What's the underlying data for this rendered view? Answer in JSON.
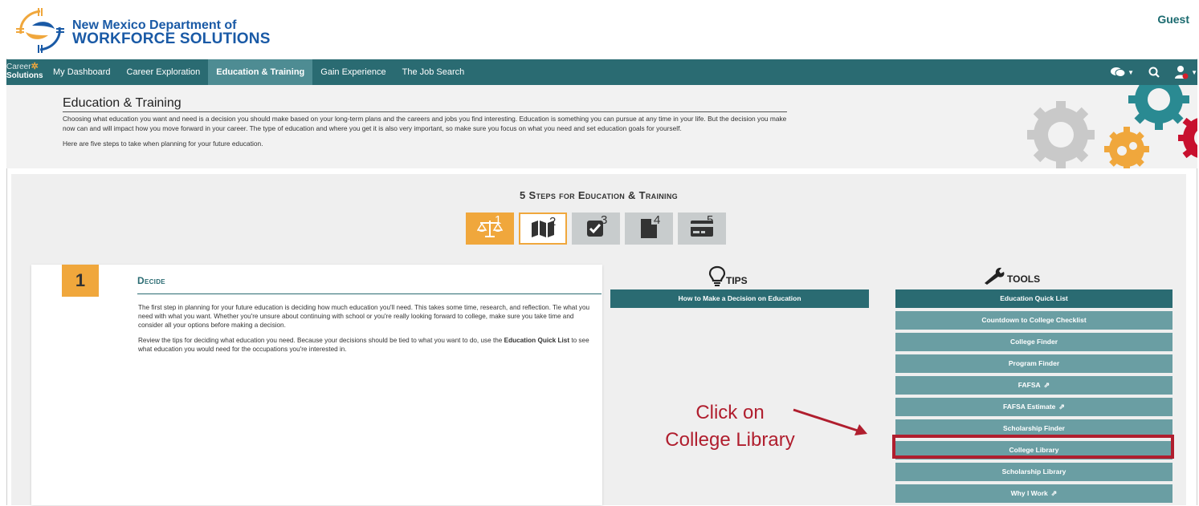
{
  "header": {
    "org_line1": "New Mexico Department of",
    "org_line2": "WORKFORCE SOLUTIONS",
    "user": "Guest"
  },
  "brand": {
    "line1": "Career",
    "line2": "Solutions"
  },
  "nav": {
    "items": [
      {
        "label": "My Dashboard"
      },
      {
        "label": "Career Exploration"
      },
      {
        "label": "Education & Training"
      },
      {
        "label": "Gain Experience"
      },
      {
        "label": "The Job Search"
      }
    ],
    "active_index": 2,
    "right_icons": [
      "chat-icon",
      "search-icon",
      "user-icon"
    ]
  },
  "intro": {
    "title": "Education & Training",
    "paragraph1": "Choosing what education you want and need is a decision you should make based on your long-term plans and the careers and jobs you find interesting. Education is something you can pursue at any time in your life. But the decision you make now can and will impact how you move forward in your career. The type of education and where you get it is also very important, so make sure you focus on what you need and set education goals for yourself.",
    "paragraph2": "Here are five steps to take when planning for your future education."
  },
  "steps": {
    "title": "5 Steps for Education & Training",
    "items": [
      {
        "num": "1",
        "icon": "scales-icon"
      },
      {
        "num": "2",
        "icon": "map-icon"
      },
      {
        "num": "3",
        "icon": "checkbox-icon"
      },
      {
        "num": "4",
        "icon": "document-icon"
      },
      {
        "num": "5",
        "icon": "credit-card-icon"
      }
    ]
  },
  "card": {
    "number": "1",
    "title": "Decide",
    "paragraph1": "The first step in planning for your future education is deciding how much education you'll need. This takes some time, research, and reflection. Tie what you need with what you want. Whether you're unsure about continuing with school or you're really looking forward to college, make sure you take time and consider all your options before making a decision.",
    "paragraph2_pre": "Review the tips for deciding what education you need. Because your decisions should be tied to what you want to do, use the ",
    "paragraph2_bold": "Education Quick List",
    "paragraph2_post": " to see what education you would need for the occupations you're interested in."
  },
  "tips": {
    "heading": "TIPS",
    "items": [
      {
        "label": "How to Make a Decision on Education"
      }
    ]
  },
  "tools": {
    "heading": "TOOLS",
    "items": [
      {
        "label": "Education Quick List"
      },
      {
        "label": "Countdown to College Checklist"
      },
      {
        "label": "College Finder"
      },
      {
        "label": "Program Finder"
      },
      {
        "label": "FAFSA"
      },
      {
        "label": "FAFSA Estimate"
      },
      {
        "label": "Scholarship Finder"
      },
      {
        "label": "College Library"
      },
      {
        "label": "Scholarship Library"
      },
      {
        "label": "Why I Work"
      }
    ]
  },
  "annotation": {
    "line1": "Click on",
    "line2": "College Library"
  },
  "colors": {
    "teal": "#2a6b72",
    "teal_light": "#6a9ea3",
    "orange": "#f0a73c",
    "highlight_red": "#b01e2e",
    "org_blue": "#1a5aa6"
  }
}
